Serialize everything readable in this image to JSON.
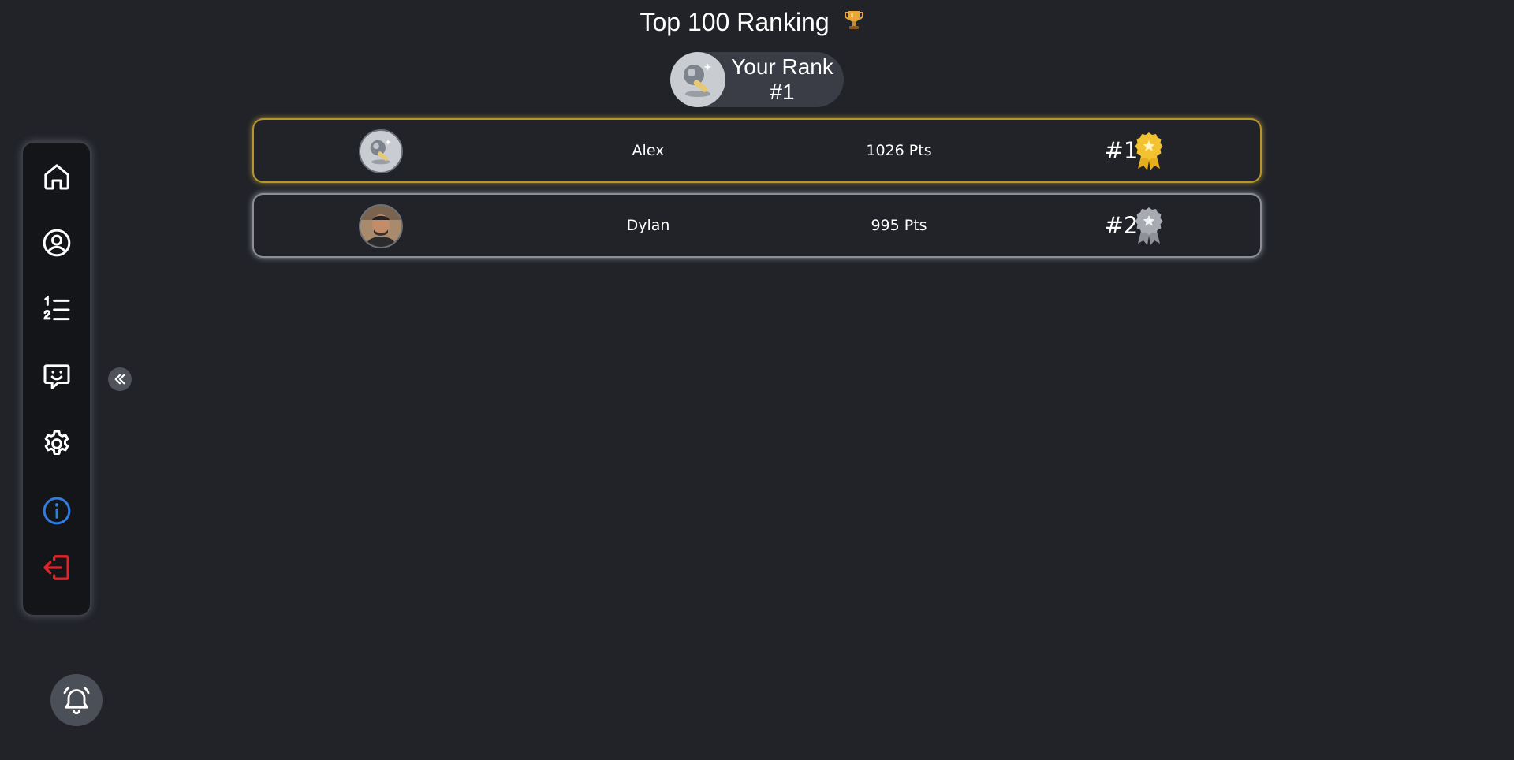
{
  "header": {
    "title": "Top 100 Ranking",
    "trophy_icon": "trophy-icon"
  },
  "your_rank": {
    "label": "Your Rank",
    "value": "#1"
  },
  "sidebar": {
    "items": [
      {
        "name": "home",
        "icon": "home-icon"
      },
      {
        "name": "profile",
        "icon": "user-circle-icon"
      },
      {
        "name": "ranking",
        "icon": "numbered-list-icon"
      },
      {
        "name": "chat",
        "icon": "chat-smile-icon"
      },
      {
        "name": "settings",
        "icon": "gear-icon"
      },
      {
        "name": "info",
        "icon": "info-icon",
        "color": "#2f7de1"
      },
      {
        "name": "logout",
        "icon": "logout-icon",
        "color": "#e0242a"
      }
    ],
    "collapse_icon": "double-chevron-left-icon"
  },
  "notifications": {
    "icon": "bell-icon"
  },
  "ranking": [
    {
      "name": "Alex",
      "points": "1026 Pts",
      "rank": "#1",
      "medal": "gold",
      "accent": "#b8962e"
    },
    {
      "name": "Dylan",
      "points": "995 Pts",
      "rank": "#2",
      "medal": "silver",
      "accent": "#8a8f98"
    }
  ],
  "colors": {
    "background": "#212329",
    "gold_medal": "#f2c230",
    "silver_medal": "#a7aab0"
  }
}
